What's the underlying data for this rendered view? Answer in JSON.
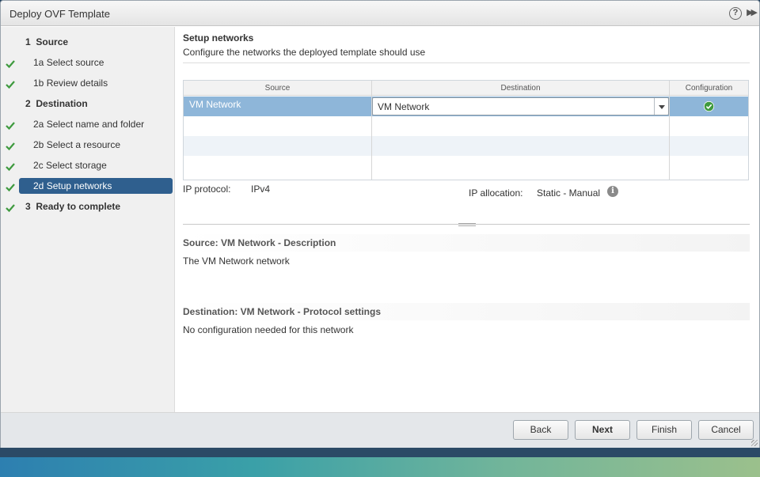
{
  "dialog": {
    "title": "Deploy OVF Template"
  },
  "steps": [
    {
      "num": "1",
      "label": "Source",
      "type": "head",
      "checked": false
    },
    {
      "num": "1a",
      "label": "Select source",
      "type": "sub",
      "checked": true
    },
    {
      "num": "1b",
      "label": "Review details",
      "type": "sub",
      "checked": true
    },
    {
      "num": "2",
      "label": "Destination",
      "type": "head",
      "checked": false
    },
    {
      "num": "2a",
      "label": "Select name and folder",
      "type": "sub",
      "checked": true
    },
    {
      "num": "2b",
      "label": "Select a resource",
      "type": "sub",
      "checked": true
    },
    {
      "num": "2c",
      "label": "Select storage",
      "type": "sub",
      "checked": true
    },
    {
      "num": "2d",
      "label": "Setup networks",
      "type": "sub",
      "checked": true,
      "active": true
    },
    {
      "num": "3",
      "label": "Ready to complete",
      "type": "head",
      "checked": true
    }
  ],
  "main": {
    "title": "Setup networks",
    "subtitle": "Configure the networks the deployed template should use",
    "grid": {
      "headers": [
        "Source",
        "Destination",
        "Configuration"
      ],
      "rows": [
        {
          "source": "VM Network",
          "destination": "VM Network",
          "configuration": "ok"
        }
      ]
    },
    "ip_protocol_label": "IP protocol:",
    "ip_protocol_value": "IPv4",
    "ip_allocation_label": "IP allocation:",
    "ip_allocation_value": "Static - Manual",
    "source_section_title": "Source: VM Network - Description",
    "source_section_body": "The VM Network network",
    "dest_section_title": "Destination: VM Network - Protocol settings",
    "dest_section_body": "No configuration needed for this network"
  },
  "footer": {
    "back": "Back",
    "next": "Next",
    "finish": "Finish",
    "cancel": "Cancel"
  },
  "colors": {
    "active_step": "#2f5f8e",
    "selected_row": "#8eb6d9",
    "check_green": "#3e9a3e"
  }
}
